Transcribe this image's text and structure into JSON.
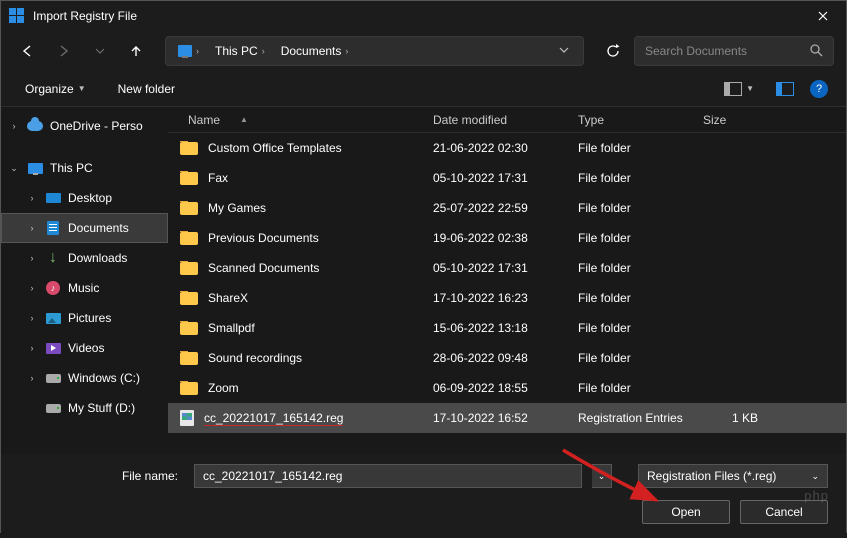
{
  "title": "Import Registry File",
  "breadcrumb": {
    "root": "This PC",
    "folder": "Documents"
  },
  "search": {
    "placeholder": "Search Documents"
  },
  "toolbar": {
    "organize": "Organize",
    "newfolder": "New folder"
  },
  "sidebar": {
    "onedrive": "OneDrive - Perso",
    "thispc": "This PC",
    "desktop": "Desktop",
    "documents": "Documents",
    "downloads": "Downloads",
    "music": "Music",
    "pictures": "Pictures",
    "videos": "Videos",
    "windowsc": "Windows (C:)",
    "mystuffd": "My Stuff (D:)"
  },
  "columns": {
    "name": "Name",
    "date": "Date modified",
    "type": "Type",
    "size": "Size"
  },
  "rows": [
    {
      "name": "Custom Office Templates",
      "date": "21-06-2022 02:30",
      "type": "File folder",
      "size": "",
      "kind": "folder"
    },
    {
      "name": "Fax",
      "date": "05-10-2022 17:31",
      "type": "File folder",
      "size": "",
      "kind": "folder"
    },
    {
      "name": "My Games",
      "date": "25-07-2022 22:59",
      "type": "File folder",
      "size": "",
      "kind": "folder"
    },
    {
      "name": "Previous Documents",
      "date": "19-06-2022 02:38",
      "type": "File folder",
      "size": "",
      "kind": "folder"
    },
    {
      "name": "Scanned Documents",
      "date": "05-10-2022 17:31",
      "type": "File folder",
      "size": "",
      "kind": "folder"
    },
    {
      "name": "ShareX",
      "date": "17-10-2022 16:23",
      "type": "File folder",
      "size": "",
      "kind": "folder"
    },
    {
      "name": "Smallpdf",
      "date": "15-06-2022 13:18",
      "type": "File folder",
      "size": "",
      "kind": "folder"
    },
    {
      "name": "Sound recordings",
      "date": "28-06-2022 09:48",
      "type": "File folder",
      "size": "",
      "kind": "folder"
    },
    {
      "name": "Zoom",
      "date": "06-09-2022 18:55",
      "type": "File folder",
      "size": "",
      "kind": "folder"
    },
    {
      "name": "cc_20221017_165142.reg",
      "date": "17-10-2022 16:52",
      "type": "Registration Entries",
      "size": "1 KB",
      "kind": "reg",
      "selected": true,
      "underlined": true
    }
  ],
  "filename": {
    "label": "File name:",
    "value": "cc_20221017_165142.reg"
  },
  "filter": "Registration Files (*.reg)",
  "buttons": {
    "open": "Open",
    "cancel": "Cancel"
  },
  "watermark": "php"
}
